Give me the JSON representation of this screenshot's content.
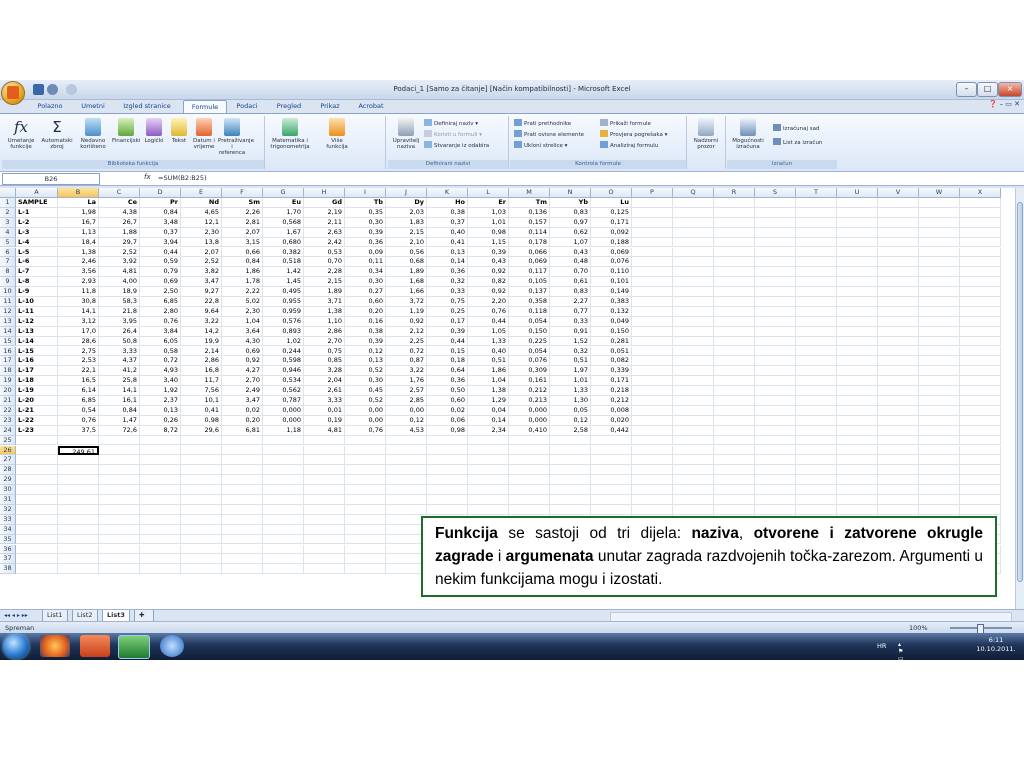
{
  "window": {
    "title": "Podaci_1  [Samo za čitanje]  [Način kompatibilnosti] - Microsoft Excel"
  },
  "ribbon_tabs": [
    "Polazno",
    "Umetni",
    "Izgled stranice",
    "Formule",
    "Podaci",
    "Pregled",
    "Prikaz",
    "Acrobat"
  ],
  "active_tab": "Formule",
  "ribbon": {
    "insert_function": "Umetanje funkcije",
    "autosum": "Automatski zbroj",
    "recent": "Nedavno korišteno",
    "financial": "Financijski",
    "logical": "Logički",
    "text": "Tekst",
    "datetime": "Datum i vrijeme",
    "lookup": "Pretraživanje i referenca",
    "math": "Matematika i trigonometrija",
    "more": "Više funkcija",
    "group_library": "Biblioteka funkcija",
    "name_manager": "Upravitelj naziva",
    "define_name": "Definiraj naziv",
    "use_in_formula": "Koristi u formuli",
    "create_from_selection": "Stvaranje iz odabira",
    "group_names": "Definirani nazivi",
    "trace_precedents": "Prati prethodnike",
    "trace_dependents": "Prati ovisne elemente",
    "remove_arrows": "Ukloni strelice",
    "show_formulas": "Prikaži formule",
    "error_checking": "Provjera pogrešaka",
    "evaluate_formula": "Analiziraj formulu",
    "watch_window": "Nadzorni prozor",
    "group_auditing": "Kontrola formule",
    "calc_options": "Mogućnosti izračuna",
    "calc_now": "Izračunaj sad",
    "calc_sheet": "List za izračun",
    "group_calc": "Izračun"
  },
  "formula_bar": {
    "name_box": "B26",
    "fx": "fx",
    "formula": "=SUM(B2:B25)"
  },
  "columns": [
    "A",
    "B",
    "C",
    "D",
    "E",
    "F",
    "G",
    "H",
    "I",
    "J",
    "K",
    "L",
    "M",
    "N",
    "O",
    "P",
    "Q",
    "R",
    "S",
    "T",
    "U",
    "V",
    "W",
    "X"
  ],
  "row_numbers": [
    "1",
    "2",
    "3",
    "4",
    "5",
    "6",
    "7",
    "8",
    "9",
    "10",
    "11",
    "12",
    "13",
    "14",
    "15",
    "16",
    "17",
    "18",
    "19",
    "20",
    "21",
    "22",
    "23",
    "24",
    "25",
    "26",
    "27",
    "28",
    "29",
    "30",
    "31",
    "32",
    "33",
    "34",
    "35",
    "36",
    "37",
    "38"
  ],
  "sheet": {
    "header": [
      "SAMPLE",
      "La",
      "Ce",
      "Pr",
      "Nd",
      "Sm",
      "Eu",
      "Gd",
      "Tb",
      "Dy",
      "Ho",
      "Er",
      "Tm",
      "Yb",
      "Lu"
    ],
    "rows": [
      [
        "L-1",
        "1,98",
        "4,38",
        "0,84",
        "4,65",
        "2,26",
        "1,70",
        "2,19",
        "0,35",
        "2,03",
        "0,38",
        "1,03",
        "0,136",
        "0,83",
        "0,125"
      ],
      [
        "L-2",
        "16,7",
        "26,7",
        "3,48",
        "12,1",
        "2,81",
        "0,568",
        "2,11",
        "0,30",
        "1,83",
        "0,37",
        "1,01",
        "0,157",
        "0,97",
        "0,171"
      ],
      [
        "L-3",
        "1,13",
        "1,88",
        "0,37",
        "2,30",
        "2,07",
        "1,67",
        "2,63",
        "0,39",
        "2,15",
        "0,40",
        "0,98",
        "0,114",
        "0,62",
        "0,092"
      ],
      [
        "L-4",
        "18,4",
        "29,7",
        "3,94",
        "13,8",
        "3,15",
        "0,680",
        "2,42",
        "0,36",
        "2,10",
        "0,41",
        "1,15",
        "0,178",
        "1,07",
        "0,188"
      ],
      [
        "L-5",
        "1,38",
        "2,52",
        "0,44",
        "2,07",
        "0,66",
        "0,382",
        "0,53",
        "0,09",
        "0,56",
        "0,13",
        "0,39",
        "0,066",
        "0,43",
        "0,069"
      ],
      [
        "L-6",
        "2,46",
        "3,92",
        "0,59",
        "2,52",
        "0,84",
        "0,518",
        "0,70",
        "0,11",
        "0,68",
        "0,14",
        "0,43",
        "0,069",
        "0,48",
        "0,076"
      ],
      [
        "L-7",
        "3,56",
        "4,81",
        "0,79",
        "3,82",
        "1,86",
        "1,42",
        "2,28",
        "0,34",
        "1,89",
        "0,36",
        "0,92",
        "0,117",
        "0,70",
        "0,110"
      ],
      [
        "L-8",
        "2,93",
        "4,00",
        "0,69",
        "3,47",
        "1,78",
        "1,45",
        "2,15",
        "0,30",
        "1,68",
        "0,32",
        "0,82",
        "0,105",
        "0,61",
        "0,101"
      ],
      [
        "L-9",
        "11,8",
        "18,9",
        "2,50",
        "9,27",
        "2,22",
        "0,495",
        "1,89",
        "0,27",
        "1,66",
        "0,33",
        "0,92",
        "0,137",
        "0,83",
        "0,149"
      ],
      [
        "L-10",
        "30,8",
        "58,3",
        "6,85",
        "22,8",
        "5,02",
        "0,955",
        "3,71",
        "0,60",
        "3,72",
        "0,75",
        "2,20",
        "0,358",
        "2,27",
        "0,383"
      ],
      [
        "L-11",
        "14,1",
        "21,8",
        "2,80",
        "9,64",
        "2,30",
        "0,959",
        "1,38",
        "0,20",
        "1,19",
        "0,25",
        "0,76",
        "0,118",
        "0,77",
        "0,132"
      ],
      [
        "L-12",
        "3,12",
        "3,95",
        "0,76",
        "3,22",
        "1,04",
        "0,576",
        "1,10",
        "0,16",
        "0,92",
        "0,17",
        "0,44",
        "0,054",
        "0,33",
        "0,049"
      ],
      [
        "L-13",
        "17,0",
        "26,4",
        "3,84",
        "14,2",
        "3,64",
        "0,893",
        "2,86",
        "0,38",
        "2,12",
        "0,39",
        "1,05",
        "0,150",
        "0,91",
        "0,150"
      ],
      [
        "L-14",
        "28,6",
        "50,8",
        "6,05",
        "19,9",
        "4,30",
        "1,02",
        "2,70",
        "0,39",
        "2,25",
        "0,44",
        "1,33",
        "0,225",
        "1,52",
        "0,281"
      ],
      [
        "L-15",
        "2,75",
        "3,33",
        "0,58",
        "2,14",
        "0,69",
        "0,244",
        "0,75",
        "0,12",
        "0,72",
        "0,15",
        "0,40",
        "0,054",
        "0,32",
        "0,051"
      ],
      [
        "L-16",
        "2,53",
        "4,37",
        "0,72",
        "2,86",
        "0,92",
        "0,598",
        "0,85",
        "0,13",
        "0,87",
        "0,18",
        "0,51",
        "0,076",
        "0,51",
        "0,082"
      ],
      [
        "L-17",
        "22,1",
        "41,2",
        "4,93",
        "16,8",
        "4,27",
        "0,946",
        "3,28",
        "0,52",
        "3,22",
        "0,64",
        "1,86",
        "0,309",
        "1,97",
        "0,339"
      ],
      [
        "L-18",
        "16,5",
        "25,8",
        "3,40",
        "11,7",
        "2,70",
        "0,534",
        "2,04",
        "0,30",
        "1,76",
        "0,36",
        "1,04",
        "0,161",
        "1,01",
        "0,171"
      ],
      [
        "L-19",
        "6,14",
        "14,1",
        "1,92",
        "7,56",
        "2,49",
        "0,562",
        "2,61",
        "0,45",
        "2,57",
        "0,50",
        "1,38",
        "0,212",
        "1,33",
        "0,218"
      ],
      [
        "L-20",
        "6,85",
        "16,1",
        "2,37",
        "10,1",
        "3,47",
        "0,787",
        "3,33",
        "0,52",
        "2,85",
        "0,60",
        "1,29",
        "0,213",
        "1,30",
        "0,212"
      ],
      [
        "L-21",
        "0,54",
        "0,84",
        "0,13",
        "0,41",
        "0,02",
        "0,000",
        "0,01",
        "0,00",
        "0,00",
        "0,02",
        "0,04",
        "0,000",
        "0,05",
        "0,008"
      ],
      [
        "L-22",
        "0,76",
        "1,47",
        "0,26",
        "0,98",
        "0,20",
        "0,000",
        "0,19",
        "0,00",
        "0,12",
        "0,06",
        "0,14",
        "0,000",
        "0,12",
        "0,020"
      ],
      [
        "L-23",
        "37,5",
        "72,6",
        "8,72",
        "29,6",
        "6,81",
        "1,18",
        "4,81",
        "0,76",
        "4,53",
        "0,98",
        "2,34",
        "0,410",
        "2,58",
        "0,442"
      ]
    ],
    "sum_value": "249,61"
  },
  "sheet_tabs": [
    "List1",
    "List2",
    "List3"
  ],
  "active_sheet": "List3",
  "status": {
    "text": "Spreman",
    "zoom": "100%"
  },
  "taskbar": {
    "lang": "HR",
    "time": "6:11",
    "date": "10.10.2011."
  },
  "callout": {
    "p1": "Funkcija",
    "p2": " se sastoji od tri dijela: ",
    "p3": "naziva",
    "p4": ", ",
    "p5": "otvorene i zatvorene okrugle zagrade",
    "p6": " i ",
    "p7": "argumenata",
    "p8": " unutar zagrada razdvojenih točka-zarezom. Argumenti u nekim funkcijama mogu i izostati."
  },
  "colors": {
    "callout_border": "#1e6b2e",
    "selected_header": "#f6c55c",
    "ribbon_text": "#15428b"
  },
  "icons": [
    "office-orb-icon",
    "save-icon",
    "undo-icon",
    "redo-icon",
    "fx-icon",
    "sigma-icon",
    "book-icon",
    "watch-window-icon",
    "calculator-icon",
    "start-orb-icon",
    "firefox-icon",
    "powerpoint-icon",
    "excel-icon",
    "help-icon"
  ]
}
